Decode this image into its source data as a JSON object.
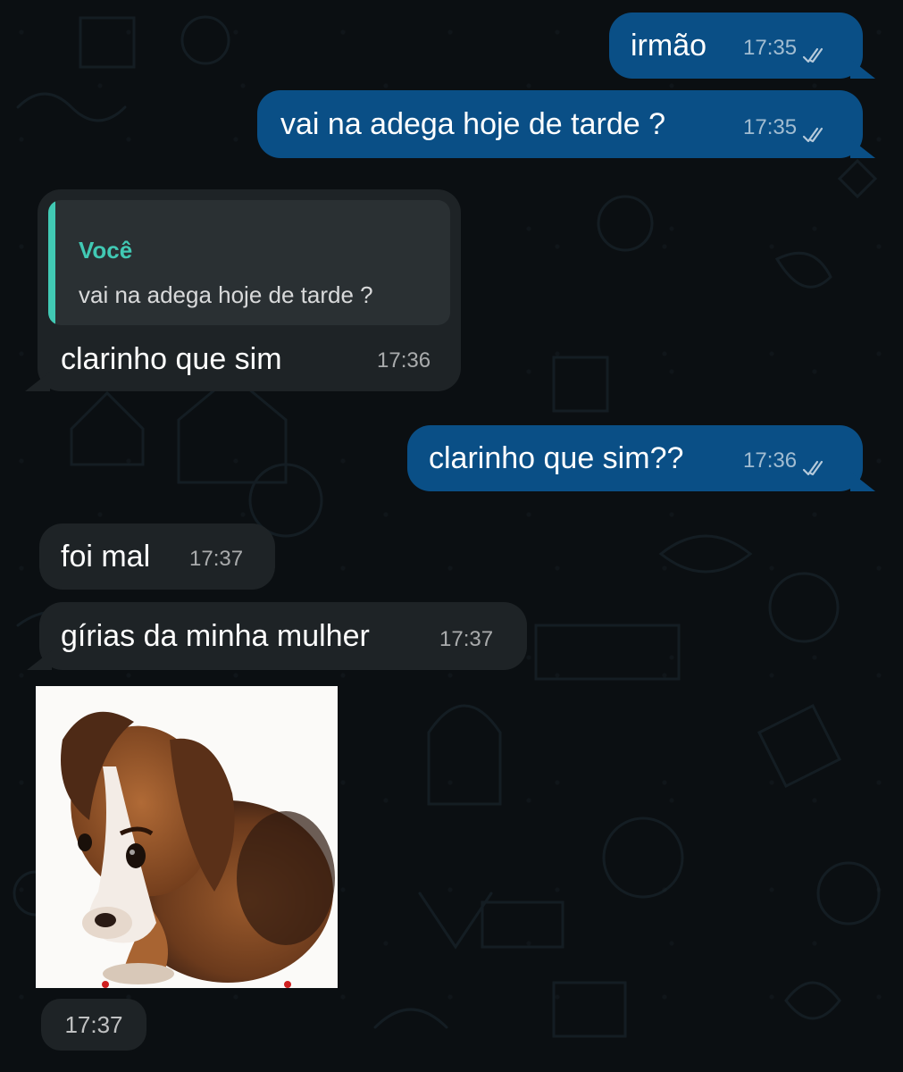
{
  "messages": [
    {
      "text": "irmão",
      "time": "17:35",
      "status_icon": "double-check-icon"
    },
    {
      "text": "vai na adega hoje de tarde ?",
      "time": "17:35",
      "status_icon": "double-check-icon"
    },
    {
      "quote_author": "Você",
      "quote_text": "vai na adega hoje de tarde ?",
      "text": "clarinho que sim",
      "time": "17:36"
    },
    {
      "text": "clarinho que sim??",
      "time": "17:36",
      "status_icon": "double-check-icon"
    },
    {
      "text": "foi mal",
      "time": "17:37"
    },
    {
      "text": "gírias da minha mulher",
      "time": "17:37"
    },
    {
      "sticker": "sad-puppy-sticker",
      "time": "17:37"
    }
  ],
  "colors": {
    "background": "#0b0f12",
    "outgoing_bubble": "#0a4f86",
    "incoming_bubble": "#1e2326",
    "quote_accent": "#41c9b4"
  }
}
